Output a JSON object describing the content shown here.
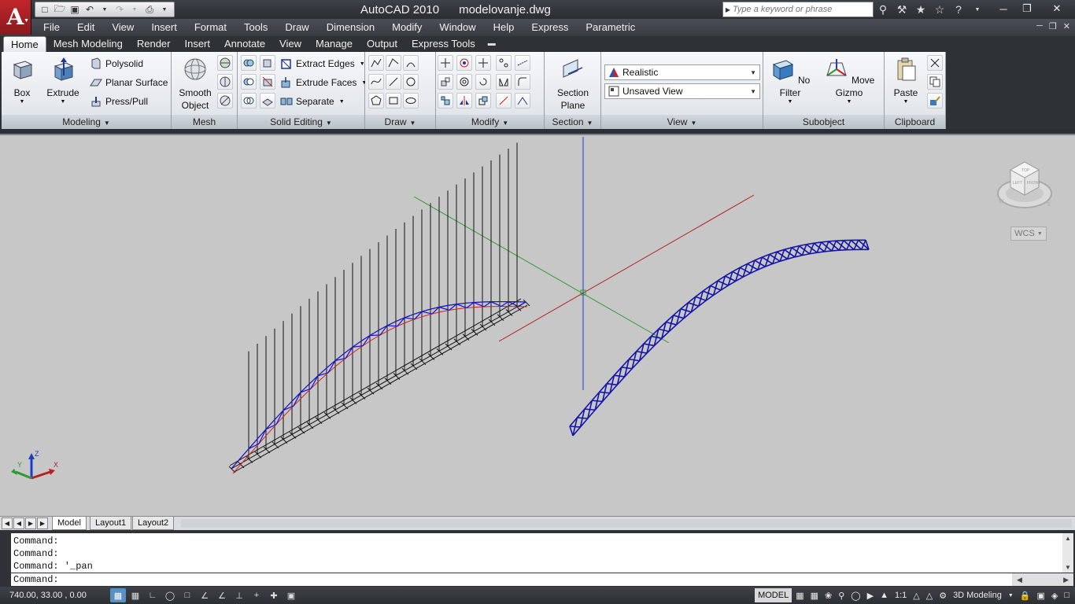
{
  "app": {
    "title": "AutoCAD 2010",
    "document": "modelovanje.dwg",
    "menu_button_glyph": "A"
  },
  "search": {
    "placeholder": "Type a keyword or phrase"
  },
  "menu": [
    "File",
    "Edit",
    "View",
    "Insert",
    "Format",
    "Tools",
    "Draw",
    "Dimension",
    "Modify",
    "Window",
    "Help",
    "Express",
    "Parametric"
  ],
  "ribbon_tabs": [
    "Home",
    "Mesh Modeling",
    "Render",
    "Insert",
    "Annotate",
    "View",
    "Manage",
    "Output",
    "Express Tools"
  ],
  "panels": {
    "modeling": {
      "label": "Modeling",
      "box": "Box",
      "extrude": "Extrude",
      "polysolid": "Polysolid",
      "planar_surface": "Planar Surface",
      "press_pull": "Press/Pull"
    },
    "mesh": {
      "label": "Mesh",
      "smooth_object": "Smooth Object"
    },
    "solid_editing": {
      "label": "Solid Editing",
      "extract_edges": "Extract Edges",
      "extrude_faces": "Extrude Faces",
      "separate": "Separate"
    },
    "draw": {
      "label": "Draw"
    },
    "modify": {
      "label": "Modify"
    },
    "section": {
      "label": "Section",
      "section_plane": "Section Plane"
    },
    "view": {
      "label": "View",
      "visual_style": "Realistic",
      "named_view": "Unsaved View"
    },
    "subobject": {
      "label": "Subobject",
      "no_filter": "No Filter",
      "move_gizmo": "Move Gizmo"
    },
    "clipboard": {
      "label": "Clipboard",
      "paste": "Paste"
    }
  },
  "viewport": {
    "wcs_label": "WCS",
    "ucs": {
      "x": "X",
      "y": "Y",
      "z": "Z"
    },
    "viewcube": {
      "top": "TOP",
      "left": "LEFT",
      "front": "FRONT",
      "compass_w": "W",
      "compass_s": "S"
    }
  },
  "layout_tabs": [
    "Model",
    "Layout1",
    "Layout2"
  ],
  "command": {
    "history": [
      "Command:",
      "Command:",
      "Command: '_pan"
    ],
    "prompt": "Command:"
  },
  "status": {
    "coordinates": "740.00, 33.00 , 0.00",
    "model_label": "MODEL",
    "annotation_scale": "1:1",
    "workspace": "3D Modeling"
  },
  "colors": {
    "viewport_bg": "#c7c7c7",
    "x_axis": "#b22222",
    "y_axis": "#2e9b2e",
    "z_axis": "#1e3ad0",
    "truss_blue": "#1414a8",
    "arch_red": "#d42020"
  }
}
